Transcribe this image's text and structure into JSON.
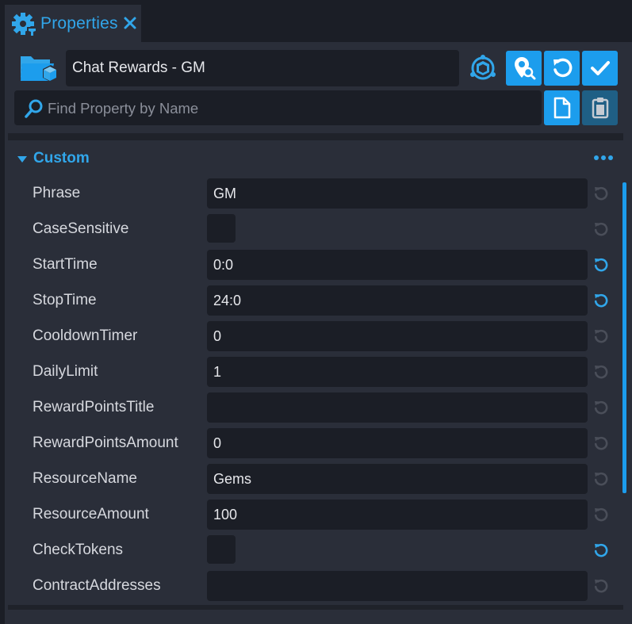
{
  "tab": {
    "title": "Properties"
  },
  "header": {
    "object_name": "Chat Rewards - GM"
  },
  "search": {
    "placeholder": "Find Property by Name"
  },
  "section": {
    "title": "Custom"
  },
  "properties": [
    {
      "label": "Phrase",
      "type": "text",
      "value": "GM",
      "reset_active": false
    },
    {
      "label": "CaseSensitive",
      "type": "checkbox",
      "checked": false,
      "reset_active": false
    },
    {
      "label": "StartTime",
      "type": "text",
      "value": "0:0",
      "reset_active": true
    },
    {
      "label": "StopTime",
      "type": "text",
      "value": "24:0",
      "reset_active": true
    },
    {
      "label": "CooldownTimer",
      "type": "text",
      "value": "0",
      "reset_active": false
    },
    {
      "label": "DailyLimit",
      "type": "text",
      "value": "1",
      "reset_active": false
    },
    {
      "label": "RewardPointsTitle",
      "type": "text",
      "value": "",
      "reset_active": false
    },
    {
      "label": "RewardPointsAmount",
      "type": "text",
      "value": "0",
      "reset_active": false
    },
    {
      "label": "ResourceName",
      "type": "text",
      "value": "Gems",
      "reset_active": false
    },
    {
      "label": "ResourceAmount",
      "type": "text",
      "value": "100",
      "reset_active": false
    },
    {
      "label": "CheckTokens",
      "type": "checkbox",
      "checked": false,
      "reset_active": true
    },
    {
      "label": "ContractAddresses",
      "type": "text",
      "value": "",
      "reset_active": false
    }
  ],
  "colors": {
    "accent": "#31a6ea",
    "button": "#1c9ded",
    "reset_inactive": "#4a4e59"
  }
}
